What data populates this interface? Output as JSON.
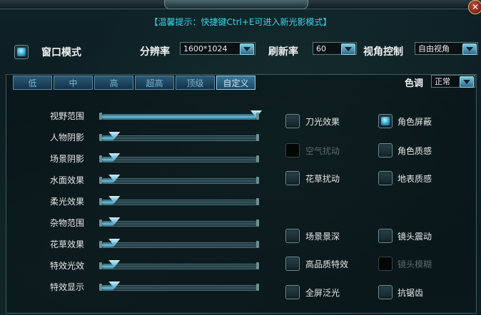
{
  "window": {
    "title": "",
    "close_glyph": "✕"
  },
  "hint": "【温馨提示：快捷键Ctrl+E可进入新光影模式】",
  "top": {
    "window_mode": {
      "label": "窗口模式",
      "checked": true
    },
    "resolution": {
      "label": "分辨率",
      "value": "1600*1024"
    },
    "refresh": {
      "label": "刷新率",
      "value": "60"
    },
    "view": {
      "label": "视角控制",
      "value": "自由视角"
    }
  },
  "tabs": [
    "低",
    "中",
    "高",
    "超高",
    "顶级",
    "自定义"
  ],
  "active_tab": "自定义",
  "tone": {
    "label": "色调",
    "value": "正常"
  },
  "sliders": [
    {
      "label": "视野范围",
      "value": 1.0
    },
    {
      "label": "人物阴影",
      "value": 0.08
    },
    {
      "label": "场景阴影",
      "value": 0.08
    },
    {
      "label": "水面效果",
      "value": 0.08
    },
    {
      "label": "柔光效果",
      "value": 0.08
    },
    {
      "label": "杂物范围",
      "value": 0.08
    },
    {
      "label": "花草效果",
      "value": 0.08
    },
    {
      "label": "特效光效",
      "value": 0.08
    },
    {
      "label": "特效显示",
      "value": 0.08
    }
  ],
  "options_left": [
    {
      "label": "刀光效果",
      "checked": false,
      "disabled": false
    },
    {
      "label": "空气扰动",
      "checked": false,
      "disabled": true
    },
    {
      "label": "花草扰动",
      "checked": false,
      "disabled": false
    },
    {
      "label": "场景景深",
      "checked": false,
      "disabled": false
    },
    {
      "label": "高品质特效",
      "checked": false,
      "disabled": false
    },
    {
      "label": "全屏泛光",
      "checked": false,
      "disabled": false
    }
  ],
  "options_right": [
    {
      "label": "角色屏蔽",
      "checked": true,
      "disabled": false
    },
    {
      "label": "角色质感",
      "checked": false,
      "disabled": false
    },
    {
      "label": "地表质感",
      "checked": false,
      "disabled": false
    },
    {
      "label": "镜头震动",
      "checked": false,
      "disabled": false
    },
    {
      "label": "镜头模糊",
      "checked": false,
      "disabled": true
    },
    {
      "label": "抗锯齿",
      "checked": false,
      "disabled": false
    }
  ]
}
